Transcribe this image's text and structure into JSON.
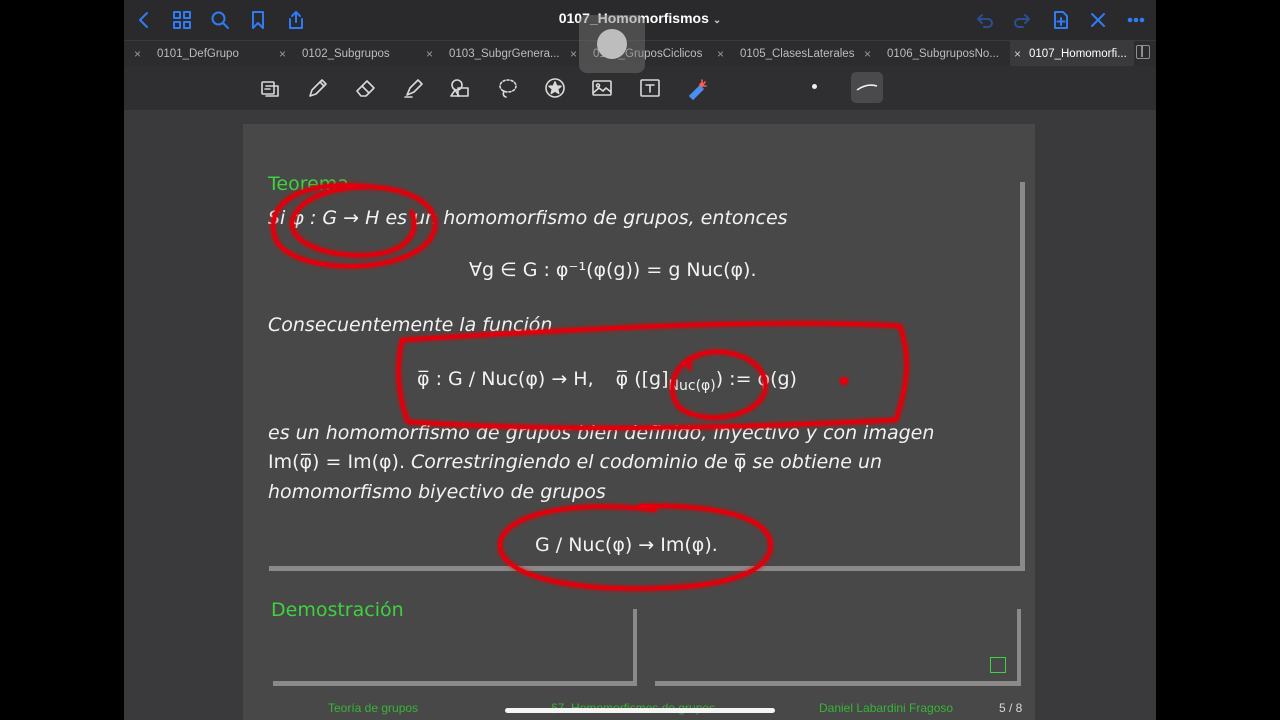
{
  "app": {
    "title": "0107_Homomorfismos",
    "title_chevron": "⌄"
  },
  "tabs": [
    {
      "label": "0101_DefGrupo",
      "active": false
    },
    {
      "label": "0102_Subgrupos",
      "active": false
    },
    {
      "label": "0103_SubgrGenera...",
      "active": false
    },
    {
      "label": "0104_GruposCiclicos",
      "active": false
    },
    {
      "label": "0105_ClasesLaterales",
      "active": false
    },
    {
      "label": "0106_SubgruposNo...",
      "active": false
    },
    {
      "label": "0107_Homomorfi...",
      "active": true
    }
  ],
  "tab_close": "×",
  "nav_icons_left": [
    "back-icon",
    "grid-icon",
    "search-icon",
    "bookmark-icon",
    "share-icon"
  ],
  "nav_icons_right": [
    "undo-icon",
    "redo-icon",
    "add-page-icon",
    "close-icon",
    "more-icon"
  ],
  "tools": [
    "lasso-select-icon",
    "pen-icon",
    "eraser-icon",
    "highlighter-icon",
    "shapes-icon",
    "lasso-icon",
    "sticker-icon",
    "image-icon",
    "text-icon",
    "laser-icon"
  ],
  "document": {
    "theorem_label": "Teorema",
    "line1_prefix": "Si",
    "line1_map": "φ : G → H",
    "line1_suffix": "es un homomorfismo de grupos, entonces",
    "formula1": "∀g ∈ G :  φ⁻¹(φ(g)) = g Nuc(φ).",
    "consequence": "Consecuentemente la función",
    "formula2_left": "φ̅ : G / Nuc(φ) → H,",
    "formula2_right_a": "φ̅ ([g]",
    "formula2_sub": "Nuc(φ)",
    "formula2_right_b": ") := φ(g)",
    "line_a": "es un homomorfismo de grupos bien definido, inyectivo y con imagen",
    "line_b_math": "Im(φ̅) = Im(φ).",
    "line_b_text": "Correstringiendo el codominio de",
    "line_b_phi": "φ̅",
    "line_b_end": "se obtiene un",
    "line_c": "homomorfismo biyectivo de grupos",
    "formula3": "G / Nuc(φ) → Im(φ).",
    "proof_label": "Demostración"
  },
  "footer": {
    "left": "Teoría de grupos",
    "center": "§7. Homomorfismos de grupos",
    "author": "Daniel Labardini Fragoso",
    "page": "5 / 8"
  },
  "colors": {
    "accent": "#2f7bf6",
    "beamer_green": "#3ed23e",
    "ink_red": "#e0000f",
    "page_bg": "#484848"
  }
}
